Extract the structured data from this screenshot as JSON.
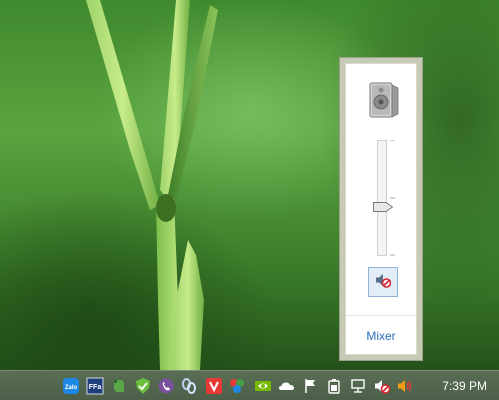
{
  "volume_flyout": {
    "volume_level": 0.45,
    "muted": true,
    "mixer_label": "Mixer"
  },
  "taskbar": {
    "tray_icons": [
      "zalo-icon",
      "foxit-ffa-icon",
      "evernote-icon",
      "shield-check-icon",
      "viber-icon",
      "link-chain-icon",
      "vivaldi-icon",
      "colorful-app-icon",
      "nvidia-icon",
      "onedrive-cloud-icon",
      "action-center-flag-icon",
      "power-battery-icon",
      "network-icon",
      "speaker-muted-icon",
      "speaker-icon"
    ],
    "clock": "7:39 PM"
  },
  "colors": {
    "accent": "#2a6fb8",
    "flyout_border": "#c7cbb6",
    "taskbar": "#4c5f48",
    "mute_red": "#d9232d"
  }
}
